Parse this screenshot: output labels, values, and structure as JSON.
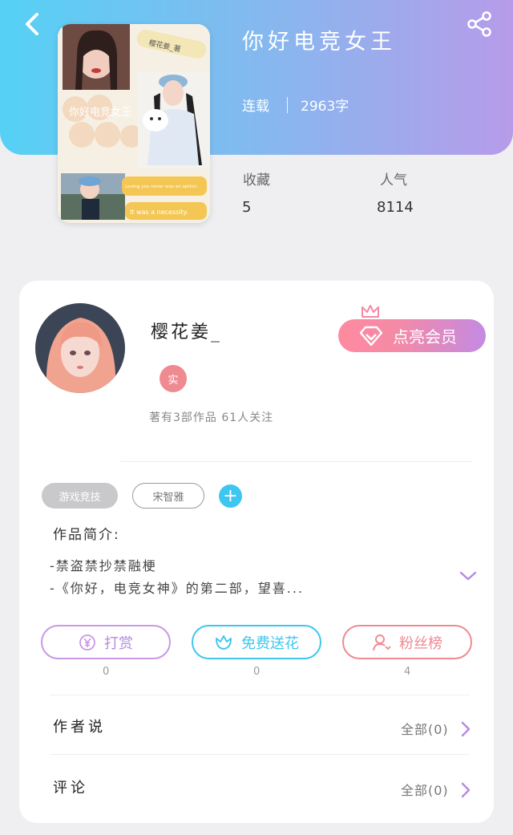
{
  "header": {
    "title": "你好电竞女王",
    "status": "连载",
    "word_count": "2963字",
    "stats": [
      {
        "label": "收藏",
        "value": "5"
      },
      {
        "label": "人气",
        "value": "8114"
      }
    ],
    "icons": {
      "back": "back-arrow-icon",
      "share": "share-icon"
    },
    "gradient_colors": [
      "#55d1f5",
      "#b79be9"
    ]
  },
  "cover": {
    "title_text": "你好电竞女王",
    "author_tag": "樱花姜_著",
    "quote_line_1": "Loving you never was an option.",
    "quote_line_2": "It was a necessity."
  },
  "author": {
    "name": "樱花姜_",
    "badge": "实",
    "meta": "著有3部作品 61人关注",
    "vip_button": "点亮会员"
  },
  "tags": [
    {
      "label": "游戏竞技"
    },
    {
      "label": "宋智雅"
    }
  ],
  "intro": {
    "title": "作品简介:",
    "lines": [
      "-禁盗禁抄禁融梗",
      "-《你好，电竞女神》的第二部，望喜..."
    ]
  },
  "actions": [
    {
      "label": "打赏",
      "count": "0",
      "color": "#c998e6",
      "icon": "yen-coin-icon"
    },
    {
      "label": "免费送花",
      "count": "0",
      "color": "#3ec6f0",
      "icon": "flower-icon"
    },
    {
      "label": "粉丝榜",
      "count": "4",
      "color": "#f08a91",
      "icon": "fans-ranking-icon"
    }
  ],
  "rows": [
    {
      "label": "作者说",
      "link": "全部(0)"
    },
    {
      "label": "评论",
      "link": "全部(0)"
    }
  ],
  "colors": {
    "accent_purple": "#b48be2",
    "accent_blue": "#3ec6f0",
    "accent_pink": "#f08a91"
  }
}
